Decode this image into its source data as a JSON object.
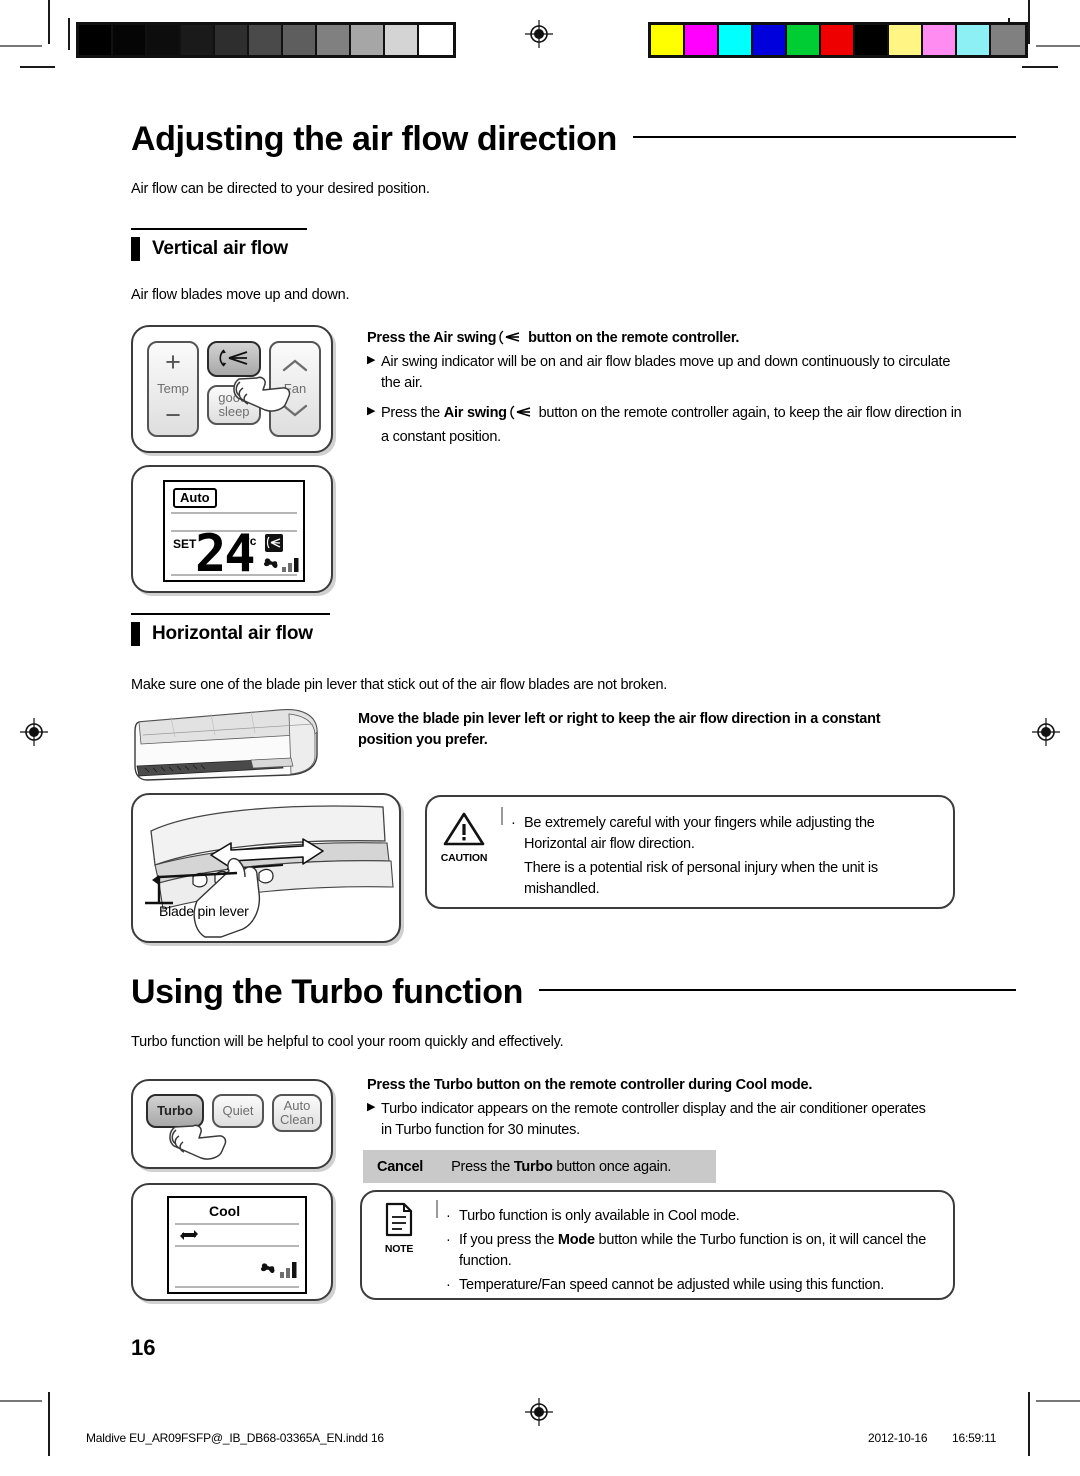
{
  "document": {
    "page_number": "16",
    "footer_file": "Maldive EU_AR09FSFP@_IB_DB68-03365A_EN.indd   16",
    "footer_date": "2012-10-16",
    "footer_time": "16:59:11"
  },
  "print_marks": {
    "grayscale_swatches": [
      "#000000",
      "#050505",
      "#0d0d0d",
      "#1a1a1a",
      "#2e2e2e",
      "#4a4a4a",
      "#5e5e5e",
      "#808080",
      "#a6a6a6",
      "#d4d4d4",
      "#ffffff"
    ],
    "color_swatches": [
      "#ffff00",
      "#ff00ff",
      "#00ffff",
      "#0000dd",
      "#00cc33",
      "#ee0000",
      "#000000",
      "#fff585",
      "#ff8cf0",
      "#8cf0f5",
      "#808080"
    ],
    "registration_icon": "registration-target-icon"
  },
  "section1": {
    "title": "Adjusting the air flow direction",
    "intro": "Air flow can be directed to your desired position.",
    "vertical": {
      "heading": "Vertical air flow",
      "intro": "Air flow blades move up and down.",
      "lead_before": "Press the ",
      "lead_bold": "Air swing",
      "lead_after": " button on the remote controller.",
      "bullets": [
        {
          "pre": "Air swing indicator will be on and air flow blades move up and down continuously to circulate the air.",
          "bold": "",
          "post": ""
        },
        {
          "pre": "Press the ",
          "bold": "Air swing",
          "post": " button on the remote controller again, to keep the air flow direction in a constant position."
        }
      ],
      "remote": {
        "temp_label": "Temp",
        "temp_plus": "+",
        "temp_minus": "−",
        "swing_button": "air-swing-icon",
        "sleep_label_1": "good'",
        "sleep_label_2": "sleep",
        "fan_label": "Fan",
        "fan_up": "⌃",
        "fan_down": "⌄"
      },
      "display": {
        "mode": "Auto",
        "set_label": "SET",
        "temperature": "24",
        "degree": "°c",
        "swing_icon": "air-swing-indicator-icon",
        "fan_icon": "fan-speed-icon"
      }
    },
    "horizontal": {
      "heading": "Horizontal air flow",
      "intro": "Make sure one of the blade pin lever that stick out of the air flow blades are not broken.",
      "lead": "Move the blade pin lever left or right to keep the air flow direction in a constant position you prefer.",
      "illustration_label": "Blade pin lever",
      "caution": {
        "label": "CAUTION",
        "icon": "warning-triangle-icon",
        "items": [
          "Be extremely careful with your fingers while adjusting the Horizontal air flow direction.",
          "There is a potential risk of personal injury when the unit is mishandled."
        ]
      }
    }
  },
  "section2": {
    "title": "Using the Turbo function",
    "intro": "Turbo function will be helpful to cool your room quickly and effectively.",
    "lead_before": "Press the ",
    "lead_bold": "Turbo",
    "lead_after": " button on the remote controller during Cool mode.",
    "bullets": [
      {
        "pre": "Turbo indicator appears on the remote controller display and the air conditioner operates in Turbo function for 30 minutes.",
        "bold": "",
        "post": ""
      }
    ],
    "cancel": {
      "title": "Cancel",
      "pre": "Press the ",
      "bold": "Turbo",
      "post": " button once again."
    },
    "remote": {
      "turbo_label": "Turbo",
      "quiet_label": "Quiet",
      "autoclean_label_1": "Auto",
      "autoclean_label_2": "Clean"
    },
    "display": {
      "mode": "Cool",
      "turbo_icon": "turbo-indicator-icon",
      "fan_icon": "fan-speed-icon"
    },
    "note": {
      "label": "NOTE",
      "icon": "note-document-icon",
      "items": [
        {
          "pre": "Turbo function is only available in Cool mode.",
          "bold": "",
          "post": ""
        },
        {
          "pre": "If you press the ",
          "bold": "Mode",
          "post": " button while the Turbo function is on, it will cancel the function."
        },
        {
          "pre": "Temperature/Fan speed cannot be adjusted while using this function.",
          "bold": "",
          "post": ""
        }
      ]
    }
  }
}
